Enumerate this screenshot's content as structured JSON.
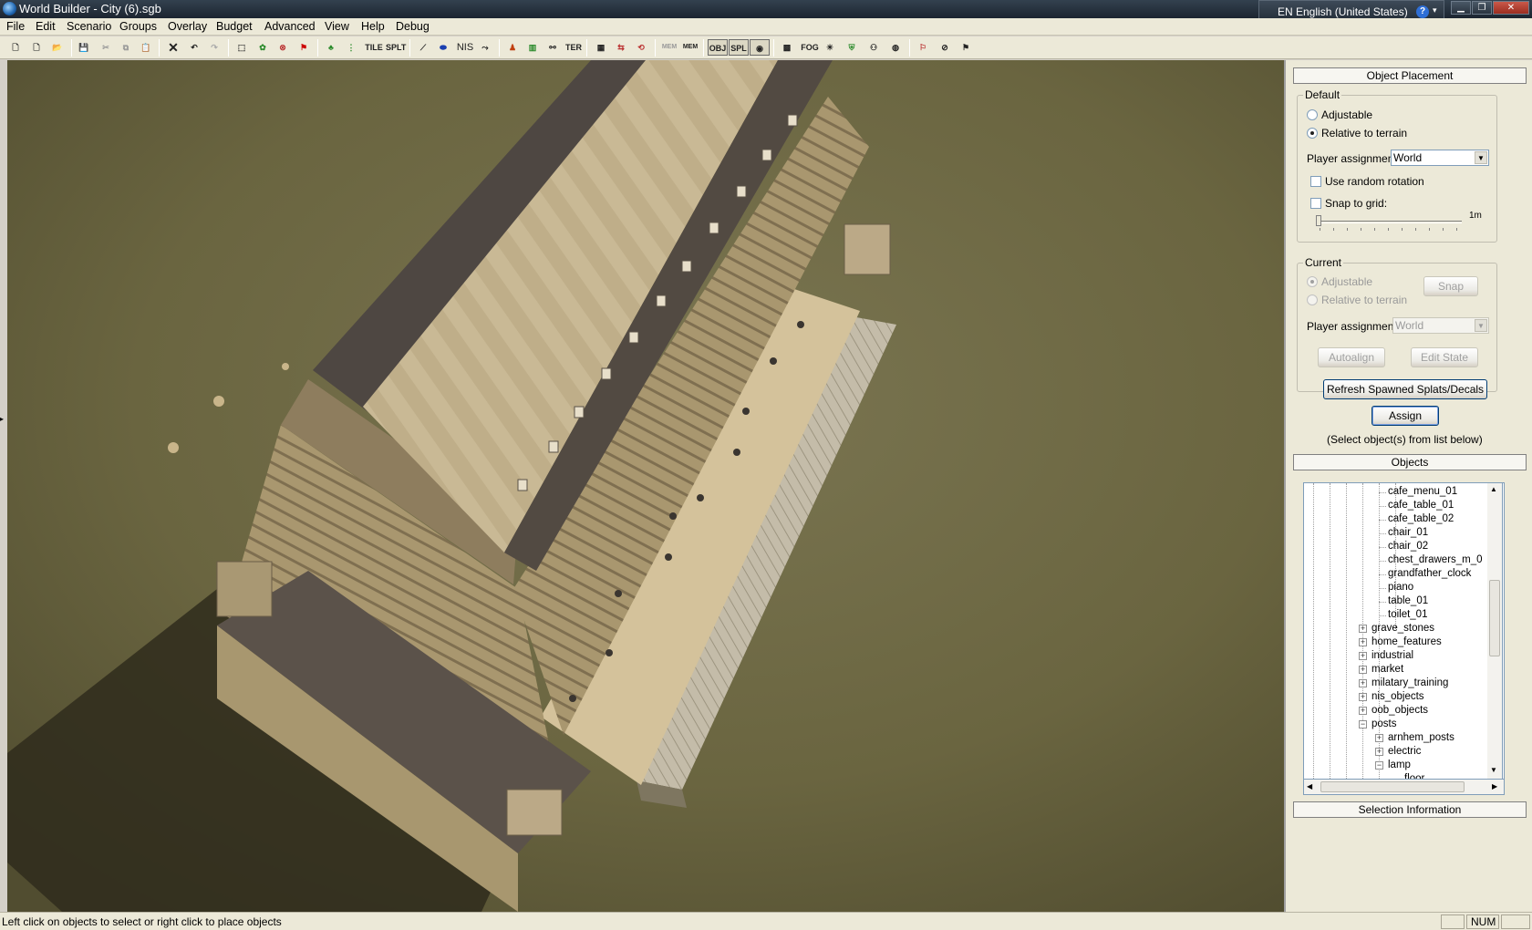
{
  "window": {
    "title": "World Builder - City (6).sgb",
    "language": "EN English (United States)",
    "help_glyph": "?"
  },
  "menubar": {
    "items": [
      "File",
      "Edit",
      "Scenario",
      "Groups",
      "Overlay",
      "Budget",
      "Advanced",
      "View",
      "Help",
      "Debug"
    ]
  },
  "toolbar": {
    "labels": {
      "tile": "TILE",
      "splt": "SPLT",
      "nis": "NIS",
      "ter": "TER",
      "mem_disp": "MEM",
      "mem": "MEM",
      "obj": "OBJ",
      "spl": "SPL",
      "fog": "FOG"
    }
  },
  "panel": {
    "object_placement": {
      "title": "Object Placement",
      "default": {
        "legend": "Default",
        "adjustable_label": "Adjustable",
        "relative_label": "Relative to terrain",
        "selected": "Relative to terrain",
        "player_assignment_label": "Player assignment:",
        "player_assignment_value": "World",
        "random_rotation_label": "Use random rotation",
        "random_rotation_checked": false,
        "snap_grid_label": "Snap to grid:",
        "snap_grid_checked": false,
        "grid_value": "1m"
      },
      "current": {
        "legend": "Current",
        "adjustable_label": "Adjustable",
        "relative_label": "Relative to terrain",
        "snap_button": "Snap",
        "player_assignment_label": "Player assignment:",
        "player_assignment_value": "World",
        "autoalign_button": "Autoalign",
        "edit_state_button": "Edit State"
      },
      "refresh_button": "Refresh Spawned Splats/Decals",
      "assign_button": "Assign",
      "hint": "(Select object(s) from list below)"
    },
    "objects": {
      "title": "Objects",
      "tree": [
        {
          "label": "cafe_menu_01",
          "depth": 5,
          "toggle": ""
        },
        {
          "label": "cafe_table_01",
          "depth": 5,
          "toggle": ""
        },
        {
          "label": "cafe_table_02",
          "depth": 5,
          "toggle": ""
        },
        {
          "label": "chair_01",
          "depth": 5,
          "toggle": ""
        },
        {
          "label": "chair_02",
          "depth": 5,
          "toggle": ""
        },
        {
          "label": "chest_drawers_m_0",
          "depth": 5,
          "toggle": ""
        },
        {
          "label": "grandfather_clock",
          "depth": 5,
          "toggle": ""
        },
        {
          "label": "piano",
          "depth": 5,
          "toggle": ""
        },
        {
          "label": "table_01",
          "depth": 5,
          "toggle": ""
        },
        {
          "label": "toilet_01",
          "depth": 5,
          "toggle": ""
        },
        {
          "label": "grave_stones",
          "depth": 4,
          "toggle": "+"
        },
        {
          "label": "home_features",
          "depth": 4,
          "toggle": "+"
        },
        {
          "label": "industrial",
          "depth": 4,
          "toggle": "+"
        },
        {
          "label": "market",
          "depth": 4,
          "toggle": "+"
        },
        {
          "label": "milatary_training",
          "depth": 4,
          "toggle": "+"
        },
        {
          "label": "nis_objects",
          "depth": 4,
          "toggle": "+"
        },
        {
          "label": "oob_objects",
          "depth": 4,
          "toggle": "+"
        },
        {
          "label": "posts",
          "depth": 4,
          "toggle": "-"
        },
        {
          "label": "arnhem_posts",
          "depth": 5,
          "toggle": "+"
        },
        {
          "label": "electric",
          "depth": 5,
          "toggle": "+"
        },
        {
          "label": "lamp",
          "depth": 5,
          "toggle": "-"
        },
        {
          "label": "floor",
          "depth": 6,
          "toggle": ""
        }
      ]
    },
    "selection_information": {
      "title": "Selection Information"
    }
  },
  "statusbar": {
    "message": "Left click on objects to select or right click to place objects",
    "num": "NUM"
  },
  "colors": {
    "grass": "#6a6640",
    "roof_light": "#c8b793",
    "roof_dark": "#4b4540",
    "facade": "#a89670",
    "terrace": "#d9c7a0"
  }
}
